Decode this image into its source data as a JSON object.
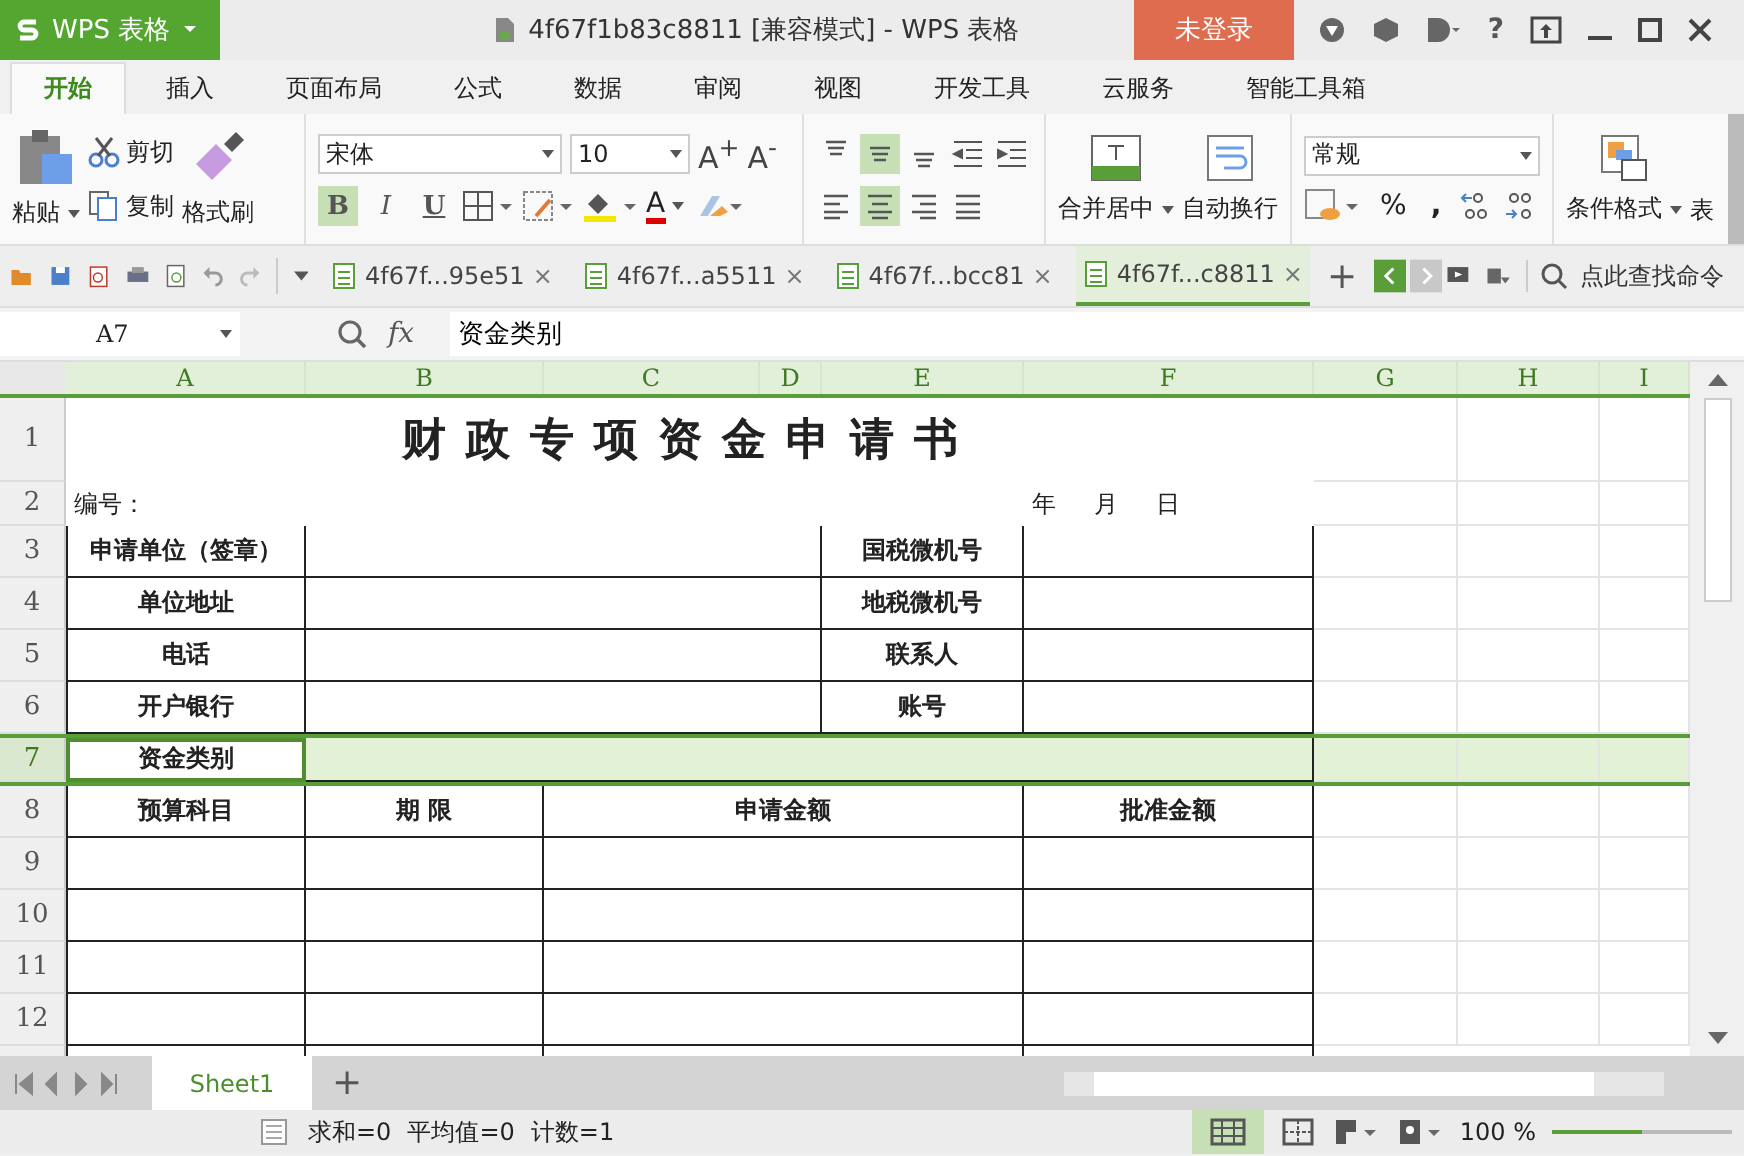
{
  "app": {
    "name": "WPS 表格"
  },
  "window": {
    "title": "4f67f1b83c8811 [兼容模式] - WPS 表格",
    "login": "未登录",
    "help": "?"
  },
  "menu_tabs": [
    {
      "label": "开始",
      "selected": true
    },
    {
      "label": "插入",
      "selected": false
    },
    {
      "label": "页面布局",
      "selected": false
    },
    {
      "label": "公式",
      "selected": false
    },
    {
      "label": "数据",
      "selected": false
    },
    {
      "label": "审阅",
      "selected": false
    },
    {
      "label": "视图",
      "selected": false
    },
    {
      "label": "开发工具",
      "selected": false
    },
    {
      "label": "云服务",
      "selected": false
    },
    {
      "label": "智能工具箱",
      "selected": false
    }
  ],
  "ribbon": {
    "paste": "粘贴",
    "cut": "剪切",
    "copy": "复制",
    "format_painter": "格式刷",
    "font": "宋体",
    "font_size": "10",
    "grow_font": "A$^{+}$",
    "shrink_font": "A$^{-}$",
    "styles": [
      {
        "label": "B",
        "selected": true
      },
      {
        "label": "I",
        "selected": false
      },
      {
        "label": "U",
        "selected": false
      }
    ],
    "font_color": "A",
    "align_top": [
      {
        "selected": false
      },
      {
        "selected": true
      },
      {
        "selected": false
      }
    ],
    "align_bottom": [
      {
        "selected": false
      },
      {
        "selected": true
      },
      {
        "selected": false
      },
      {
        "selected": false
      }
    ],
    "merge": "合并居中",
    "wrap": "自动换行",
    "number_format": "常规",
    "percent": "%",
    "comma": ",",
    "conditional_format": "条件格式",
    "table_format": "表"
  },
  "doc_tabs": [
    {
      "label": "4f67f...95e51",
      "close": "×",
      "selected": false
    },
    {
      "label": "4f67f...a5511",
      "close": "×",
      "selected": false
    },
    {
      "label": "4f67f...bcc81",
      "close": "×",
      "selected": false
    },
    {
      "label": "4f67f...c8811",
      "close": "×",
      "selected": true
    }
  ],
  "new_tab": "+",
  "command_search": {
    "placeholder": "点此查找命令"
  },
  "formula_bar": {
    "cell": "A7",
    "fx": "fx",
    "value": "资金类别"
  },
  "sheet": {
    "columns": [
      "A",
      "B",
      "C",
      "D",
      "E",
      "F",
      "G",
      "H",
      "I"
    ],
    "rows": [
      {
        "header": "1",
        "kind": "title",
        "selected": false,
        "cells": [
          "财政专项资金申请书"
        ]
      },
      {
        "header": "2",
        "kind": "info",
        "selected": false,
        "cells": [
          "编号：",
          "年     月     日"
        ]
      },
      {
        "header": "3",
        "kind": "pair",
        "selected": false,
        "cells": [
          "申请单位（签章）",
          "国税微机号"
        ]
      },
      {
        "header": "4",
        "kind": "pair",
        "selected": false,
        "cells": [
          "单位地址",
          "地税微机号"
        ]
      },
      {
        "header": "5",
        "kind": "pair",
        "selected": false,
        "cells": [
          "电话",
          "联系人"
        ]
      },
      {
        "header": "6",
        "kind": "pair",
        "selected": false,
        "cells": [
          "开户银行",
          "账号"
        ]
      },
      {
        "header": "7",
        "kind": "category",
        "selected": true,
        "cells": [
          "资金类别"
        ]
      },
      {
        "header": "8",
        "kind": "budget",
        "selected": false,
        "cells": [
          "预算科目",
          "期 限",
          "申请金额",
          "批准金额"
        ]
      },
      {
        "header": "9",
        "kind": "budget",
        "selected": false
      },
      {
        "header": "10",
        "kind": "budget",
        "selected": false
      },
      {
        "header": "11",
        "kind": "budget",
        "selected": false
      },
      {
        "header": "12",
        "kind": "budget",
        "selected": false
      }
    ]
  },
  "sheet_tabs": [
    {
      "label": "Sheet1",
      "selected": true
    }
  ],
  "add_sheet": "+",
  "status": {
    "sum": "求和=0",
    "average": "平均值=0",
    "count": "计数=1",
    "zoom": "100 %",
    "zoom_slider": {
      "level": 0.5
    }
  }
}
